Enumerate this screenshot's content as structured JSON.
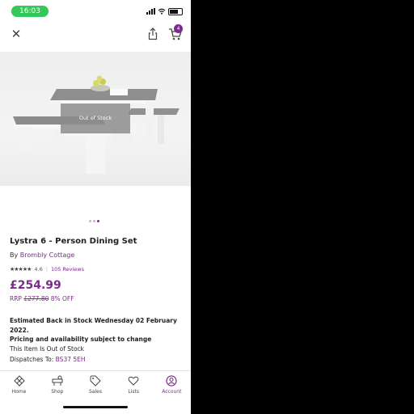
{
  "status": {
    "time": "16:03"
  },
  "header": {
    "cart_count": "4"
  },
  "hero": {
    "overlay_text": "Out of Stock",
    "carousel_dots": 3,
    "active_dot": 2
  },
  "product": {
    "title": "Lystra 6 - Person Dining Set",
    "by_prefix": "By",
    "brand": "Brombly Cottage",
    "rating_value": 4.6,
    "rating_text": "4.6",
    "reviews": "105 Reviews",
    "price": "£254.99",
    "rrp_label": "RRP",
    "rrp_price": "£277.80",
    "discount": "8% OFF"
  },
  "availability": {
    "estimate": "Estimated Back in Stock Wednesday 02 February 2022.",
    "pricing_note": "Pricing and availability subject to change",
    "stock_status": "This Item Is Out of Stock",
    "dispatch_label": "Dispatches To:",
    "postcode": "BS37 5EH"
  },
  "nav": {
    "items": [
      {
        "label": "Home",
        "icon": "home-icon"
      },
      {
        "label": "Shop",
        "icon": "shop-icon"
      },
      {
        "label": "Sales",
        "icon": "sales-tag-icon"
      },
      {
        "label": "Lists",
        "icon": "heart-icon"
      },
      {
        "label": "Account",
        "icon": "account-icon"
      }
    ],
    "active_index": 4
  },
  "colors": {
    "accent": "#7b2c8b",
    "status_pill": "#34c759"
  }
}
